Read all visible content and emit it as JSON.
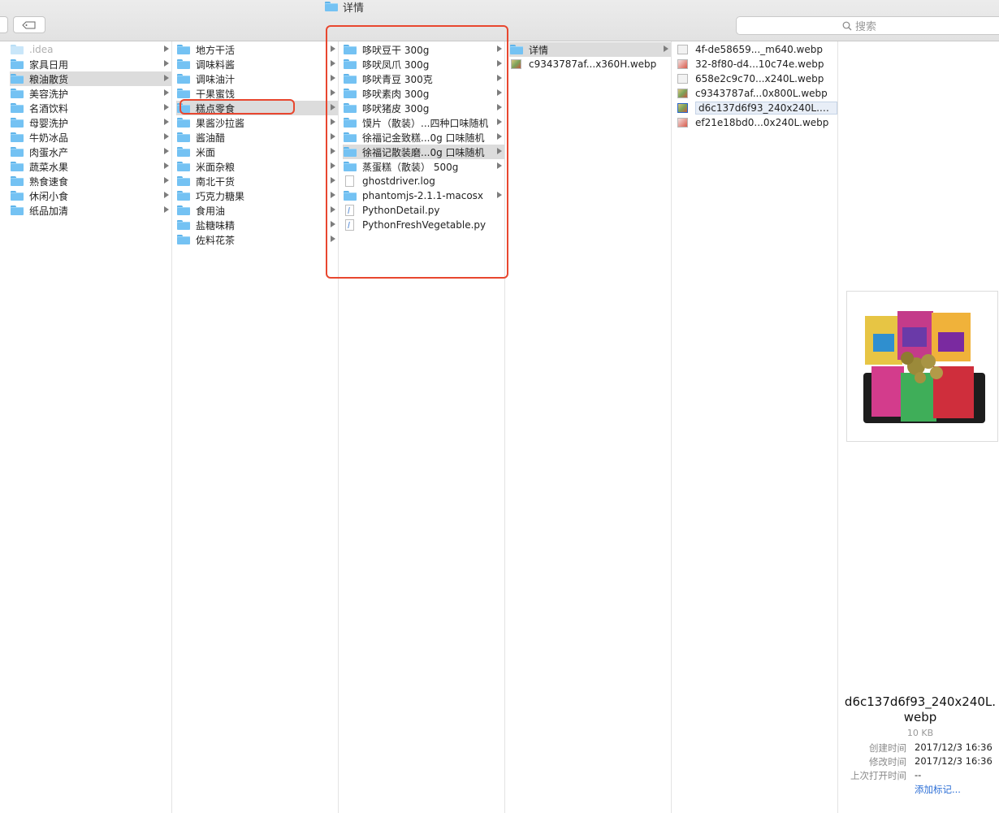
{
  "window": {
    "title": "详情",
    "search_placeholder": "搜索"
  },
  "columns": [
    {
      "items": [
        {
          "label": ".idea",
          "icon": "folder",
          "dim": true
        },
        {
          "label": "家具日用",
          "icon": "folder"
        },
        {
          "label": "粮油散货",
          "icon": "folder",
          "selected": true
        },
        {
          "label": "美容洗护",
          "icon": "folder"
        },
        {
          "label": "名酒饮料",
          "icon": "folder"
        },
        {
          "label": "母婴洗护",
          "icon": "folder"
        },
        {
          "label": "牛奶冰品",
          "icon": "folder"
        },
        {
          "label": "肉蛋水产",
          "icon": "folder"
        },
        {
          "label": "蔬菜水果",
          "icon": "folder"
        },
        {
          "label": "熟食速食",
          "icon": "folder"
        },
        {
          "label": "休闲小食",
          "icon": "folder"
        },
        {
          "label": "纸品加清",
          "icon": "folder"
        }
      ]
    },
    {
      "items": [
        {
          "label": "地方干活",
          "icon": "folder"
        },
        {
          "label": "调味料酱",
          "icon": "folder"
        },
        {
          "label": "调味油汁",
          "icon": "folder"
        },
        {
          "label": "干果蜜饯",
          "icon": "folder"
        },
        {
          "label": "糕点零食",
          "icon": "folder",
          "selected": true
        },
        {
          "label": "果酱沙拉酱",
          "icon": "folder"
        },
        {
          "label": "酱油醋",
          "icon": "folder"
        },
        {
          "label": "米面",
          "icon": "folder"
        },
        {
          "label": "米面杂粮",
          "icon": "folder"
        },
        {
          "label": "南北干货",
          "icon": "folder"
        },
        {
          "label": "巧克力糖果",
          "icon": "folder"
        },
        {
          "label": "食用油",
          "icon": "folder"
        },
        {
          "label": "盐糖味精",
          "icon": "folder"
        },
        {
          "label": "佐料花茶",
          "icon": "folder"
        }
      ]
    },
    {
      "items": [
        {
          "label": "哆吠豆干 300g",
          "icon": "folder"
        },
        {
          "label": "哆吠凤爪 300g",
          "icon": "folder"
        },
        {
          "label": "哆吠青豆 300克",
          "icon": "folder"
        },
        {
          "label": "哆吠素肉 300g",
          "icon": "folder"
        },
        {
          "label": "哆吠猪皮 300g",
          "icon": "folder"
        },
        {
          "label": "馍片（散装）...四种口味随机",
          "icon": "folder"
        },
        {
          "label": "徐福记金致糕...0g 口味随机",
          "icon": "folder"
        },
        {
          "label": "徐福记散装磨...0g 口味随机",
          "icon": "folder",
          "selected": true
        },
        {
          "label": "蒸蛋糕（散装） 500g",
          "icon": "folder"
        },
        {
          "label": "ghostdriver.log",
          "icon": "doc"
        },
        {
          "label": "phantomjs-2.1.1-macosx",
          "icon": "folder"
        },
        {
          "label": "PythonDetail.py",
          "icon": "py"
        },
        {
          "label": "PythonFreshVegetable.py",
          "icon": "py"
        }
      ]
    },
    {
      "items": [
        {
          "label": "详情",
          "icon": "folder",
          "selected": true
        },
        {
          "label": "c9343787af...x360H.webp",
          "icon": "thumb"
        }
      ]
    },
    {
      "items": [
        {
          "label": "4f-de58659..._m640.webp",
          "icon": "thumb-plain"
        },
        {
          "label": "32-8f80-d4...10c74e.webp",
          "icon": "thumb-red"
        },
        {
          "label": "658e2c9c70...x240L.webp",
          "icon": "thumb-plain"
        },
        {
          "label": "c9343787af...0x800L.webp",
          "icon": "thumb"
        },
        {
          "label": "d6c137d6f93_240x240L.webp",
          "icon": "thumb",
          "selected": true
        },
        {
          "label": "ef21e18bd0...0x240L.webp",
          "icon": "thumb-red"
        }
      ]
    }
  ],
  "preview": {
    "name": "d6c137d6f93_240x240L.webp",
    "size": "10 KB",
    "meta": [
      {
        "key": "创建时间",
        "value": "2017/12/3 16:36"
      },
      {
        "key": "修改时间",
        "value": "2017/12/3 16:36"
      },
      {
        "key": "上次打开时间",
        "value": "--"
      }
    ],
    "add_tag": "添加标记..."
  }
}
